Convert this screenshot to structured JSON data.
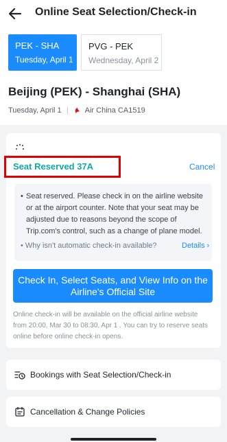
{
  "header": {
    "title": "Online Seat Selection/Check-in",
    "back_icon": "arrow-left-icon"
  },
  "segments": [
    {
      "route": "PEK - SHA",
      "date": "Tuesday, April 1",
      "selected": true
    },
    {
      "route": "PVG - PEK",
      "date": "Wednesday, April 2",
      "selected": false
    }
  ],
  "flight": {
    "title": "Beijing (PEK) - Shanghai (SHA)",
    "date": "Tuesday, April 1",
    "airline": "Air China CA1519",
    "airline_logo_icon": "air-china-logo-icon"
  },
  "seat": {
    "status": "Seat Reserved 37A",
    "cancel_label": "Cancel"
  },
  "notice": {
    "bullet": "•",
    "text": "Seat reserved. Please check in on the airline website or at the airport counter. Note that your seat may be adjusted due to reasons beyond the scope of Trip.com's control, such as a change of plane model.",
    "question": "• Why isn't automatic check-in available?",
    "details_label": "Details ›"
  },
  "cta": {
    "label": "Check In, Select Seats, and View Info on the Airline's Official Site"
  },
  "footnote": "Online check-in will be available on the official airline website from 20:00, Mar 30 to 08:30, Apr 1 . You can try to reserve seats online before online check-in opens.",
  "links": [
    {
      "label": "Bookings with Seat Selection/Check-in",
      "icon": "history-icon"
    },
    {
      "label": "Cancellation & Change Policies",
      "icon": "calendar-policy-icon"
    }
  ],
  "colors": {
    "primary": "#1a8cff",
    "teal": "#0fa8a8",
    "highlight_box": "#e00000",
    "airline_red": "#d71920"
  }
}
